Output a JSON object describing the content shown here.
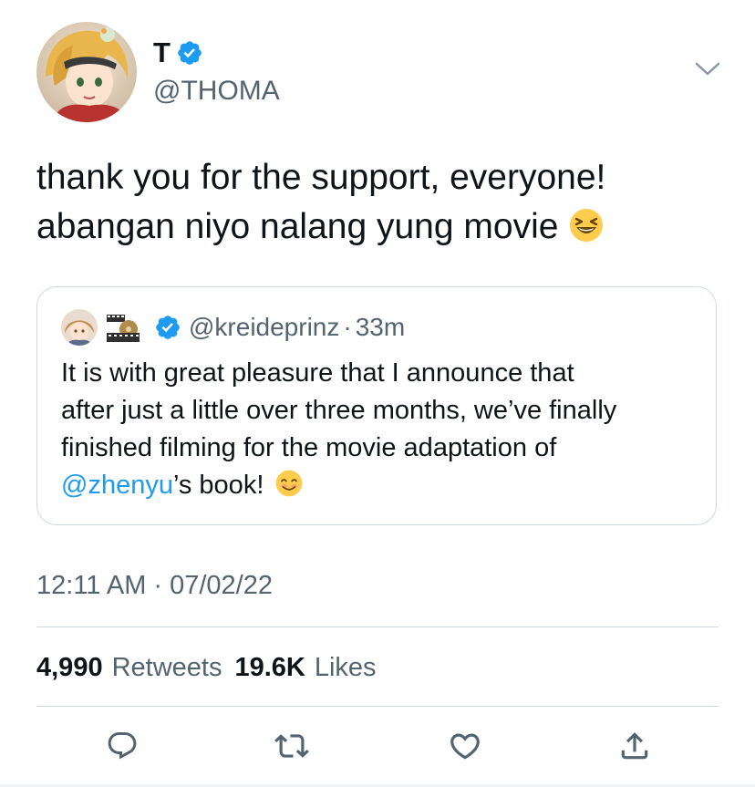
{
  "author": {
    "display_name": "T",
    "handle": "@THOMA",
    "verified": true
  },
  "tweet": {
    "lines": [
      "thank you for the support, everyone!",
      "abangan niyo nalang yung movie"
    ],
    "emoji": "squinting-laughing-face"
  },
  "quote": {
    "handle": "@kreideprinz",
    "dot": "·",
    "time": "33m",
    "verified": true,
    "lines": [
      "It is with great pleasure that I announce that",
      "after just a little over three months, we’ve finally",
      "finished filming for the movie adaptation of"
    ],
    "last_line_mention": "@zhenyu",
    "last_line_rest": "’s book!",
    "emoji": "smiling-face"
  },
  "meta": {
    "time": "12:11 AM",
    "dot": "·",
    "date": "07/02/22"
  },
  "stats": {
    "retweets_count": "4,990",
    "retweets_label": "Retweets",
    "likes_count": "19.6K",
    "likes_label": "Likes"
  },
  "actions": [
    "reply-icon",
    "retweet-icon",
    "like-icon",
    "share-icon"
  ],
  "colors": {
    "accent": "#1d9bf0",
    "secondary_text": "#536471",
    "border": "#cfd9de"
  }
}
